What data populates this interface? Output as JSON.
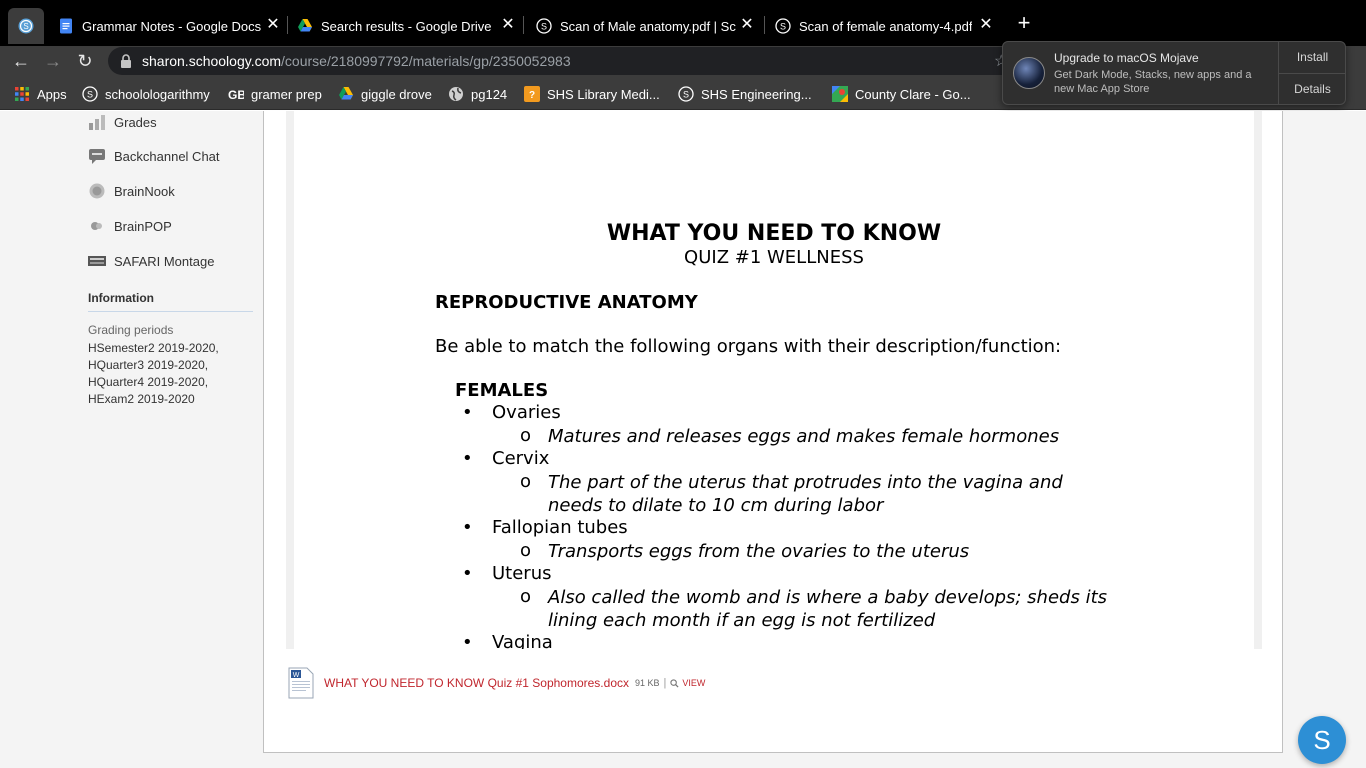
{
  "tabs": [
    {
      "title": "",
      "icon": "schoology-icon"
    },
    {
      "title": "Grammar Notes - Google Docs",
      "icon": "google-docs-icon"
    },
    {
      "title": "Search results - Google Drive",
      "icon": "google-drive-icon"
    },
    {
      "title": "Scan of Male anatomy.pdf | Sc",
      "icon": "schoology-icon"
    },
    {
      "title": "Scan of female anatomy-4.pdf",
      "icon": "schoology-icon"
    }
  ],
  "toolbar": {
    "url_host": "sharon.schoology.com",
    "url_path": "/course/2180997792/materials/gp/2350052983"
  },
  "bookmarks": [
    {
      "label": "Apps"
    },
    {
      "label": "schoolologarithmy"
    },
    {
      "label": "gramer prep"
    },
    {
      "label": "giggle drove"
    },
    {
      "label": "pg124"
    },
    {
      "label": "SHS Library Medi..."
    },
    {
      "label": "SHS Engineering..."
    },
    {
      "label": "County Clare - Go..."
    }
  ],
  "notification": {
    "title": "Upgrade to macOS Mojave",
    "body": "Get Dark Mode, Stacks, new apps and a new Mac App Store",
    "install": "Install",
    "details": "Details"
  },
  "sidebar": {
    "items": [
      {
        "label": "Grades"
      },
      {
        "label": "Backchannel Chat"
      },
      {
        "label": "BrainNook"
      },
      {
        "label": "BrainPOP"
      },
      {
        "label": "SAFARI Montage"
      }
    ],
    "info_heading": "Information",
    "grading_label": "Grading periods",
    "grading_periods": [
      "HSemester2 2019-2020,",
      "HQuarter3 2019-2020,",
      "HQuarter4 2019-2020,",
      "HExam2 2019-2020"
    ]
  },
  "document": {
    "title": "WHAT YOU NEED TO KNOW",
    "subtitle": "QUIZ #1 WELLNESS",
    "heading": "REPRODUCTIVE ANATOMY",
    "instruction": "Be able to match the following organs with their description/function:",
    "females_label": "FEMALES",
    "bullet": "•",
    "sub_bullet": "o",
    "organs": [
      {
        "name": "Ovaries",
        "desc": "Matures and releases eggs and makes female hormones"
      },
      {
        "name": "Cervix",
        "desc": "The part of the uterus that protrudes into the vagina and needs to dilate to 10 cm during labor"
      },
      {
        "name": "Fallopian tubes",
        "desc": "Transports eggs from the ovaries to the uterus"
      },
      {
        "name": "Uterus",
        "desc": "Also called the womb and is where a baby develops; sheds its lining each month if an egg is not fertilized"
      },
      {
        "name": "Vagina",
        "desc": ""
      }
    ]
  },
  "attachment": {
    "filename": "WHAT YOU NEED TO KNOW Quiz #1 Sophomores.docx",
    "size": "91 KB",
    "separator": "|",
    "view": "VIEW"
  },
  "fab_label": "S",
  "colors": {
    "accent_red": "#c0262d",
    "schoology_blue": "#2d8fd5"
  }
}
